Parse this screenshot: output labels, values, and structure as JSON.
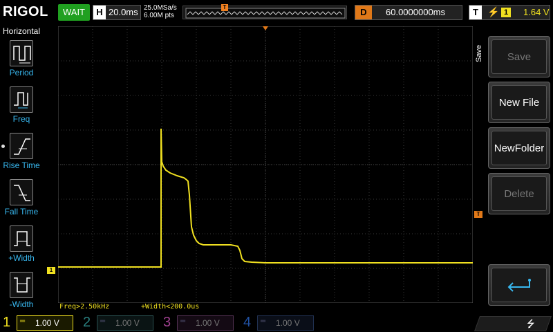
{
  "topbar": {
    "logo": "RIGOL",
    "run_state": "WAIT",
    "horizontal_key": "H",
    "timebase": "20.0ms",
    "sample_rate": "25.0MSa/s",
    "memory_depth": "6.00M pts",
    "trigger_marker": "T",
    "delay_key": "D",
    "delay_value": "60.0000000ms",
    "trigger_key": "T",
    "trigger_source": "1",
    "trigger_level": "1.64 V"
  },
  "leftpanel": {
    "title": "Horizontal",
    "items": [
      {
        "label": "Period",
        "icon": "period-icon"
      },
      {
        "label": "Freq",
        "icon": "freq-icon"
      },
      {
        "label": "Rise Time",
        "icon": "rise-time-icon"
      },
      {
        "label": "Fall Time",
        "icon": "fall-time-icon"
      },
      {
        "label": "+Width",
        "icon": "positive-width-icon"
      },
      {
        "label": "-Width",
        "icon": "negative-width-icon"
      }
    ]
  },
  "rightmenu": {
    "title": "Save",
    "buttons": [
      {
        "label": "Save",
        "enabled": false
      },
      {
        "label": "New File",
        "enabled": true
      },
      {
        "label": "NewFolder",
        "enabled": true
      },
      {
        "label": "Delete",
        "enabled": false
      },
      {
        "label": "",
        "icon": "enter-icon",
        "enabled": true
      }
    ]
  },
  "measurements": {
    "freq": "Freq>2.50kHz",
    "width": "+Width<200.0us"
  },
  "channel_marker": "1",
  "trigger_level_marker": "T",
  "channels": [
    {
      "num": "1",
      "coupling": "═",
      "scale": "1.00 V",
      "color": "#f0e020",
      "active": true
    },
    {
      "num": "2",
      "coupling": "═",
      "scale": "1.00 V",
      "color": "#2a8080",
      "active": false
    },
    {
      "num": "3",
      "coupling": "═",
      "scale": "1.00 V",
      "color": "#a04090",
      "active": false
    },
    {
      "num": "4",
      "coupling": "═",
      "scale": "1.00 V",
      "color": "#2050a0",
      "active": false
    }
  ],
  "usb_icon": "usb-icon",
  "colors": {
    "ch1": "#f0e020",
    "trigger": "#e07818",
    "menu_label": "#38b8f0"
  }
}
